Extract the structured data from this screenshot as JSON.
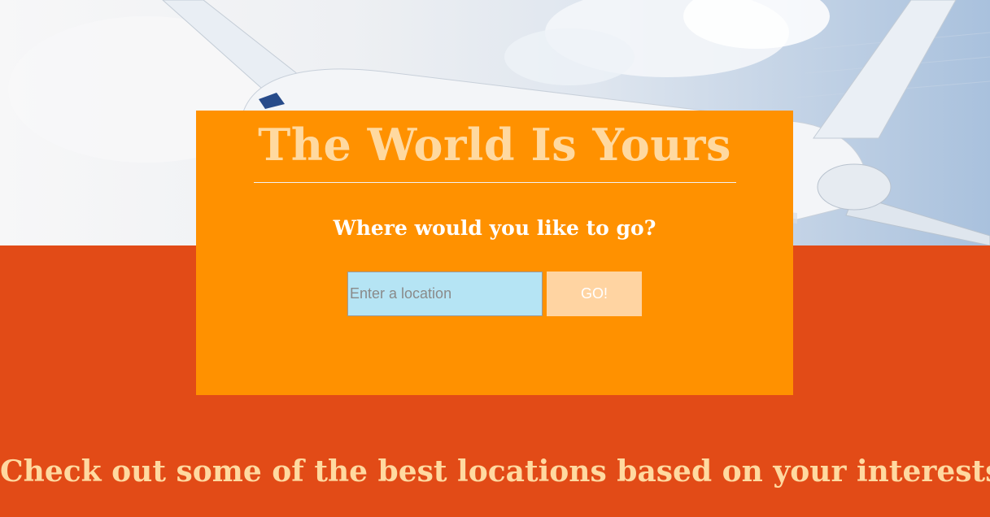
{
  "hero": {
    "image": "airplane-in-sky"
  },
  "search_panel": {
    "title": "The World Is Yours",
    "subtitle": "Where would you like to go?",
    "location_input": {
      "placeholder": "Enter a location",
      "value": ""
    },
    "go_button_label": "GO!"
  },
  "interests": {
    "heading": "Check out some of the best locations based on your interests"
  },
  "colors": {
    "panel": "#ff9100",
    "band": "#e24b17",
    "title_text": "#ffd9a0",
    "input_bg": "#b5e4f4",
    "button_bg": "#ffd4a2"
  }
}
